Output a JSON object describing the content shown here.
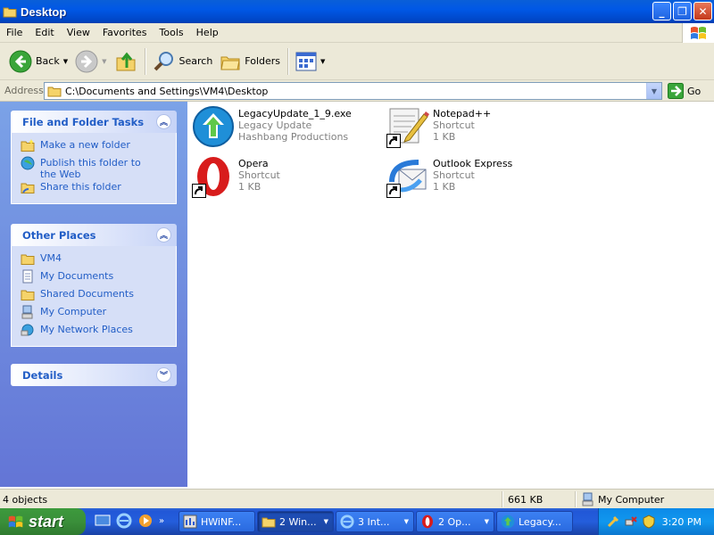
{
  "window": {
    "title": "Desktop",
    "buttons": [
      "minimize",
      "maximize",
      "close"
    ]
  },
  "menu": {
    "items": [
      "File",
      "Edit",
      "View",
      "Favorites",
      "Tools",
      "Help"
    ]
  },
  "toolbar": {
    "back": "Back",
    "search": "Search",
    "folders": "Folders"
  },
  "address": {
    "label": "Address",
    "path": "C:\\Documents and Settings\\VM4\\Desktop",
    "go": "Go"
  },
  "tasks_panel": {
    "title": "File and Folder Tasks",
    "items": [
      "Make a new folder",
      "Publish this folder to the Web",
      "Share this folder"
    ]
  },
  "places_panel": {
    "title": "Other Places",
    "items": [
      "VM4",
      "My Documents",
      "Shared Documents",
      "My Computer",
      "My Network Places"
    ]
  },
  "details_panel": {
    "title": "Details"
  },
  "files": [
    {
      "name": "LegacyUpdate_1_9.exe",
      "line2": "Legacy Update",
      "line3": "Hashbang Productions",
      "icon": "legacy-update-icon"
    },
    {
      "name": "Notepad++",
      "line2": "Shortcut",
      "line3": "1 KB",
      "icon": "notepad-plus-plus-icon"
    },
    {
      "name": "Opera",
      "line2": "Shortcut",
      "line3": "1 KB",
      "icon": "opera-icon"
    },
    {
      "name": "Outlook Express",
      "line2": "Shortcut",
      "line3": "1 KB",
      "icon": "outlook-express-icon"
    }
  ],
  "status": {
    "objects": "4 objects",
    "size": "661 KB",
    "location": "My Computer"
  },
  "taskbar": {
    "start": "start",
    "tasks": [
      {
        "label": "HWiNF...",
        "icon": "hwinfo-icon",
        "active": false,
        "dropdown": false
      },
      {
        "label": "2 Win...",
        "icon": "folder-icon",
        "active": true,
        "dropdown": true
      },
      {
        "label": "3 Int...",
        "icon": "ie-icon",
        "active": false,
        "dropdown": true
      },
      {
        "label": "2 Op...",
        "icon": "opera-icon",
        "active": false,
        "dropdown": true
      },
      {
        "label": "Legacy...",
        "icon": "legacy-update-icon",
        "active": false,
        "dropdown": false
      }
    ],
    "clock": "3:20 PM"
  },
  "colors": {
    "title_blue": "#0058e6",
    "link_blue": "#215dc6",
    "task_pane": "#6375d6",
    "start_green": "#3a8f3a"
  }
}
